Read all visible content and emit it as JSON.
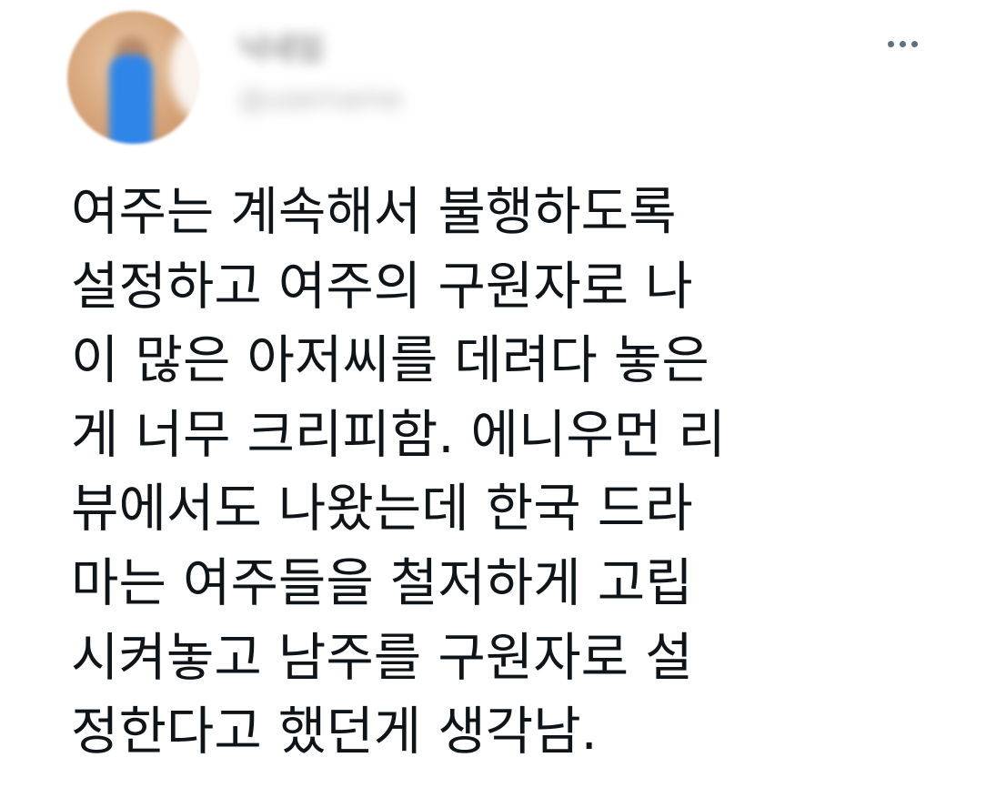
{
  "tweet": {
    "display_name": "닉네임",
    "handle": "@username",
    "more_icon": "more-horizontal-icon",
    "text_lines": [
      "여주는 계속해서 불행하도록",
      "설정하고 여주의 구원자로 나",
      "이 많은 아저씨를 데려다 놓은",
      "게 너무 크리피함. 에니우먼 리",
      "뷰에서도 나왔는데 한국 드라",
      "마는 여주들을 철저하게 고립",
      "시켜놓고 남주를 구원자로 설",
      "정한다고 했던게 생각남."
    ]
  }
}
